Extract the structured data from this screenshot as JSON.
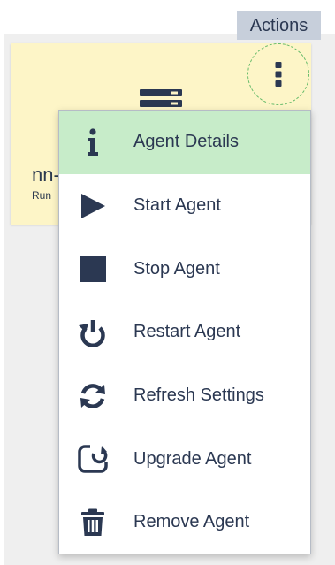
{
  "header": {
    "actions_label": "Actions"
  },
  "agent_card": {
    "name": "nn-",
    "status": "Run"
  },
  "colors": {
    "icon": "#2b3852",
    "active_item_bg": "#c7ecc9",
    "card_bg": "#fdf5c7"
  },
  "menu": {
    "items": [
      {
        "label": "Agent Details",
        "icon": "info-icon",
        "active": true
      },
      {
        "label": "Start Agent",
        "icon": "play-icon",
        "active": false
      },
      {
        "label": "Stop Agent",
        "icon": "stop-icon",
        "active": false
      },
      {
        "label": "Restart Agent",
        "icon": "restart-icon",
        "active": false
      },
      {
        "label": "Refresh Settings",
        "icon": "refresh-icon",
        "active": false
      },
      {
        "label": "Upgrade Agent",
        "icon": "upgrade-icon",
        "active": false
      },
      {
        "label": "Remove Agent",
        "icon": "trash-icon",
        "active": false
      }
    ]
  }
}
